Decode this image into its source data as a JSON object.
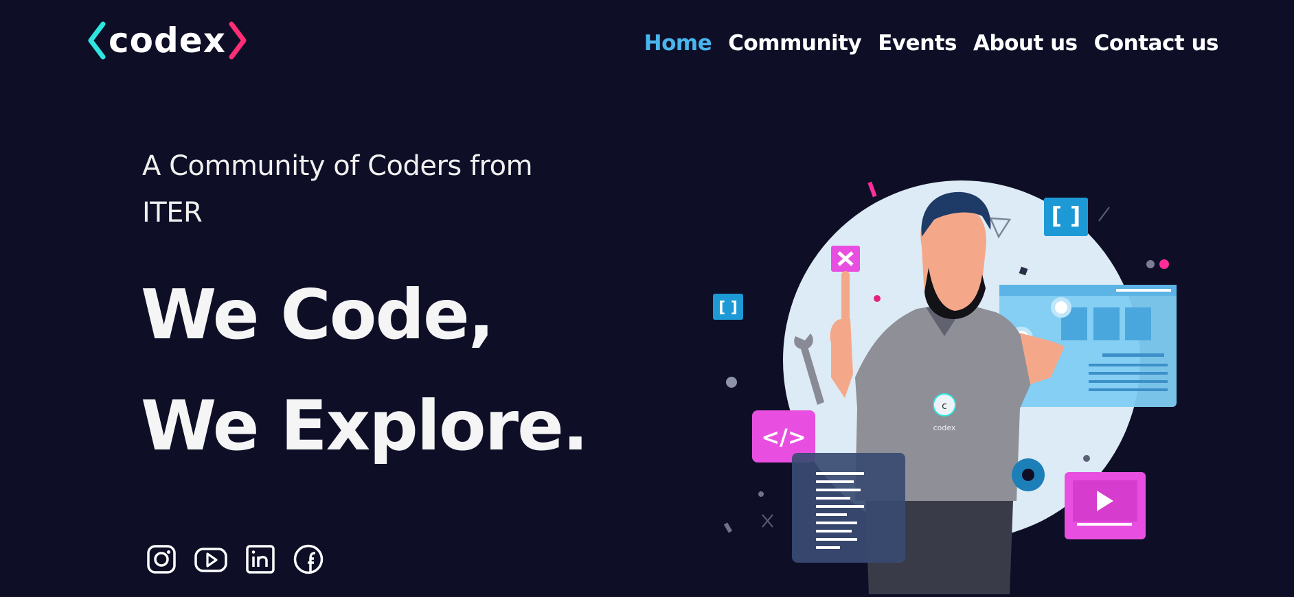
{
  "logo": {
    "text": "codex",
    "left_bracket_color": "#2ee5e0",
    "right_bracket_color": "#ff2e74",
    "icon": "codex-logo-brackets"
  },
  "nav": {
    "items": [
      {
        "label": "Home",
        "active": true
      },
      {
        "label": "Community",
        "active": false
      },
      {
        "label": "Events",
        "active": false
      },
      {
        "label": "About us",
        "active": false
      },
      {
        "label": "Contact us",
        "active": false
      }
    ],
    "active_color": "#49b5ee"
  },
  "hero": {
    "tagline": "A Community of Coders from ITER",
    "headline_line1": "We Code,",
    "headline_line2": "We Explore."
  },
  "socials": [
    "instagram-icon",
    "youtube-icon",
    "linkedin-icon",
    "facebook-icon"
  ],
  "illustration": {
    "shirt_logo": "codex",
    "shirt_logo_letter": "c",
    "bracket_badge": "[ ]",
    "code_badge": "</>"
  },
  "colors": {
    "background": "#0e0f27",
    "accent_cyan": "#2ee5e0",
    "accent_pink": "#ff2e74",
    "magenta_cards": "#e84fe0",
    "blue_cards": "#1d9ad6"
  }
}
